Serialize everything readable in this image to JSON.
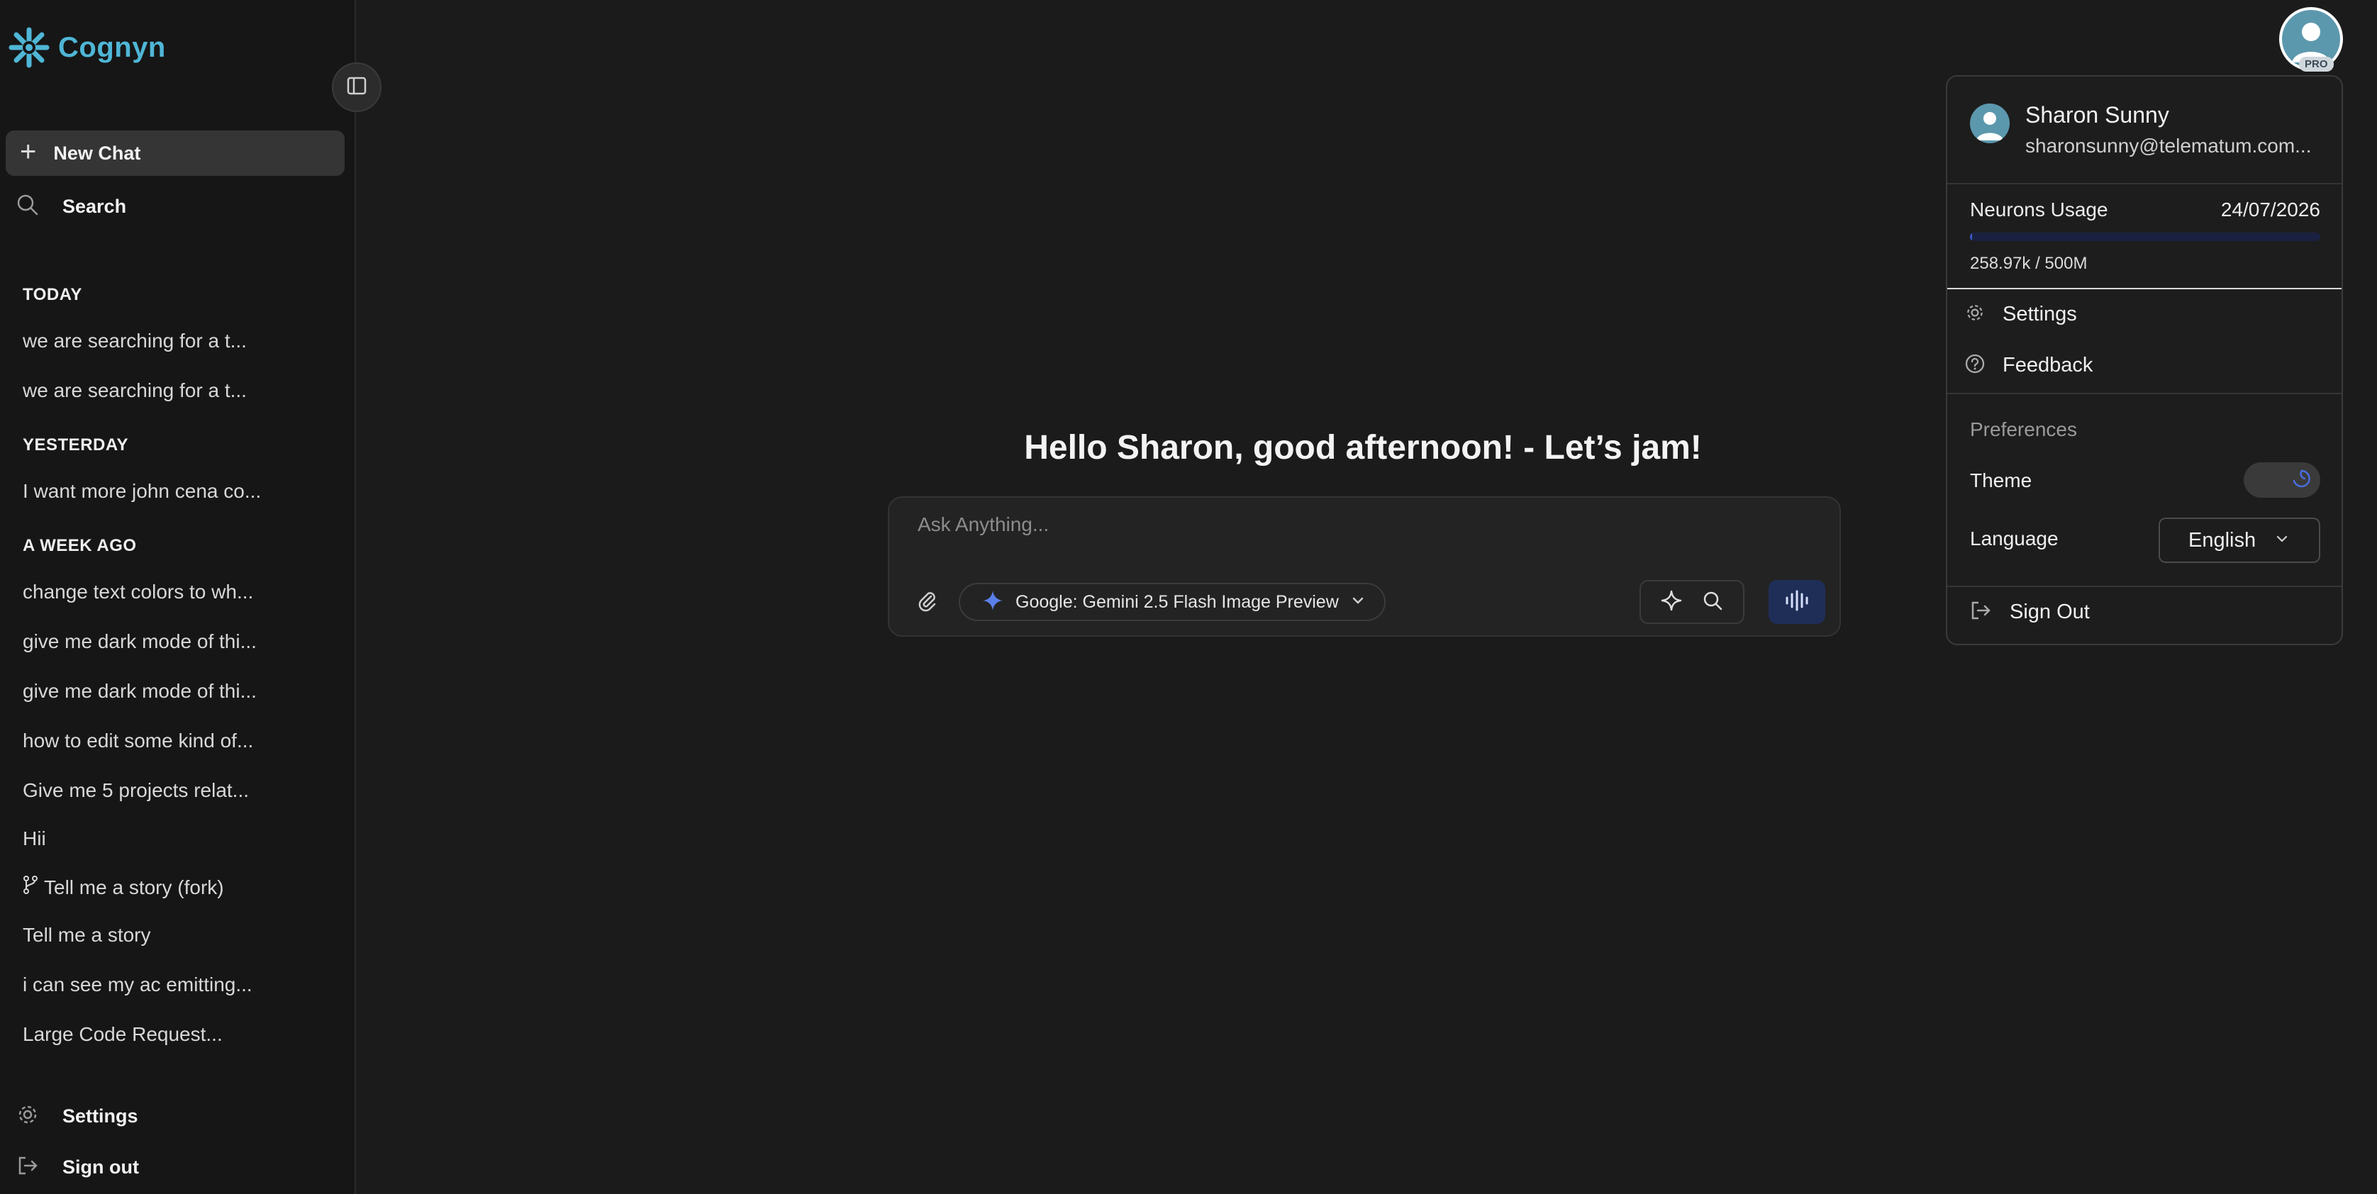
{
  "brand": {
    "name": "Cognyn",
    "color": "#4fb6d6"
  },
  "sidebar": {
    "new_chat": "New Chat",
    "search": "Search",
    "sections": [
      {
        "title": "TODAY",
        "items": [
          "we are searching for a t...",
          "we are searching for a t..."
        ]
      },
      {
        "title": "YESTERDAY",
        "items": [
          "I want more john cena co..."
        ]
      },
      {
        "title": "A WEEK AGO",
        "items": [
          "change text colors to wh...",
          "give me dark mode of thi...",
          "give me dark mode of thi...",
          "how to edit some kind of...",
          "Give me 5 projects relat...",
          "Hii",
          "Tell me a story (fork)",
          "Tell me a story",
          "i can see my ac emitting...",
          "Large Code Request..."
        ]
      }
    ],
    "forked_item_icon": "git-fork-icon",
    "settings": "Settings",
    "sign_out": "Sign out"
  },
  "main": {
    "greeting": "Hello Sharon, good afternoon! - Let’s jam!",
    "composer": {
      "placeholder": "Ask Anything...",
      "model": "Google: Gemini 2.5 Flash Image Preview",
      "voice_button_color": "#1f2e57"
    }
  },
  "account": {
    "badge": "PRO",
    "name": "Sharon Sunny",
    "email": "sharonsunny@telematum.com...",
    "usage": {
      "title": "Neurons Usage",
      "date": "24/07/2026",
      "text": "258.97k / 500M",
      "fraction": 0.0005,
      "bar_color": "#3b59c9"
    },
    "menu": {
      "settings": "Settings",
      "feedback": "Feedback"
    },
    "preferences": {
      "title": "Preferences",
      "theme_label": "Theme",
      "language_label": "Language",
      "language_value": "English"
    },
    "sign_out": "Sign Out"
  }
}
